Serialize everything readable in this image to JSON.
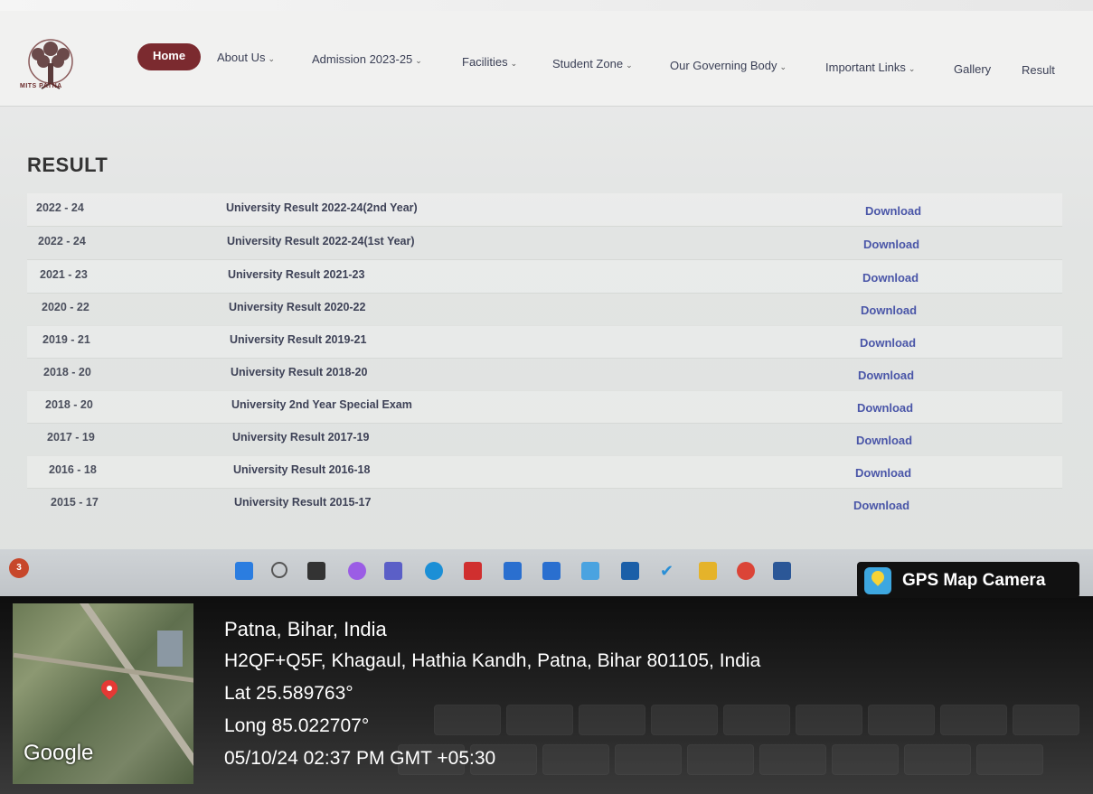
{
  "nav": {
    "logo_text": "MITS PATNA",
    "items": [
      {
        "label": "Home"
      },
      {
        "label": "About Us",
        "dropdown": true
      },
      {
        "label": "Admission 2023-25",
        "dropdown": true
      },
      {
        "label": "Facilities",
        "dropdown": true
      },
      {
        "label": "Student Zone",
        "dropdown": true
      },
      {
        "label": "Our Governing Body",
        "dropdown": true
      },
      {
        "label": "Important Links",
        "dropdown": true
      },
      {
        "label": "Gallery",
        "dropdown": false
      },
      {
        "label": "Result",
        "dropdown": false
      }
    ]
  },
  "page": {
    "heading": "RESULT"
  },
  "results": [
    {
      "year": "2022 - 24",
      "title": "University Result 2022-24(2nd Year)",
      "link": "Download"
    },
    {
      "year": "2022 - 24",
      "title": "University Result 2022-24(1st Year)",
      "link": "Download"
    },
    {
      "year": "2021 - 23",
      "title": "University Result 2021-23",
      "link": "Download"
    },
    {
      "year": "2020 - 22",
      "title": "University Result 2020-22",
      "link": "Download"
    },
    {
      "year": "2019 - 21",
      "title": "University Result 2019-21",
      "link": "Download"
    },
    {
      "year": "2018 - 20",
      "title": "University Result 2018-20",
      "link": "Download"
    },
    {
      "year": "2018 - 20",
      "title": "University 2nd Year Special Exam",
      "link": "Download"
    },
    {
      "year": "2017 - 19",
      "title": "University Result 2017-19",
      "link": "Download"
    },
    {
      "year": "2016 - 18",
      "title": "University Result 2016-18",
      "link": "Download"
    },
    {
      "year": "2015 - 17",
      "title": "University Result 2015-17",
      "link": "Download"
    }
  ],
  "taskbar": {
    "notification_count": "3",
    "icons": [
      "windows-start-icon",
      "search-icon",
      "file-explorer-icon",
      "copilot-icon",
      "teams-icon",
      "edge-icon",
      "mcafee-icon",
      "store-icon",
      "office-icon",
      "app-icon",
      "app-icon-2",
      "todo-icon",
      "folder-icon",
      "chrome-icon",
      "word-icon"
    ]
  },
  "gps": {
    "badge": "GPS Map Camera",
    "map_label": "Google",
    "place": "Patna, Bihar, India",
    "address": "H2QF+Q5F, Khagaul, Hathia Kandh, Patna, Bihar 801105, India",
    "lat": "Lat 25.589763°",
    "long": "Long 85.022707°",
    "timestamp": "05/10/24 02:37 PM GMT +05:30"
  },
  "colors": {
    "brand": "#7b2a2f",
    "link": "#4a56a8"
  }
}
